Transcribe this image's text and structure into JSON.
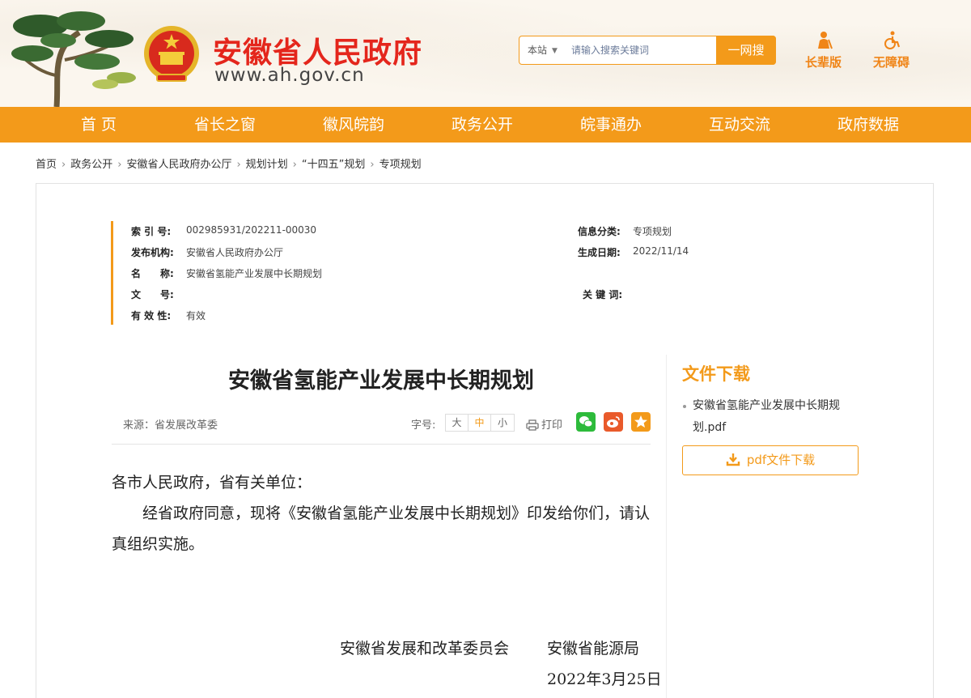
{
  "site": {
    "name": "安徽省人民政府",
    "url": "www.ah.gov.cn"
  },
  "search": {
    "scope": "本站",
    "placeholder": "请输入搜索关键词",
    "button": "一网搜"
  },
  "tools": {
    "elder": "长辈版",
    "accessible": "无障碍"
  },
  "nav": [
    "首 页",
    "省长之窗",
    "徽风皖韵",
    "政务公开",
    "皖事通办",
    "互动交流",
    "政府数据"
  ],
  "breadcrumb": [
    "首页",
    "政务公开",
    "安徽省人民政府办公厅",
    "规划计划",
    "“十四五”规划",
    "专项规划"
  ],
  "info": {
    "index_label": "索 引 号:",
    "index_value": "002985931/202211-00030",
    "category_label": "信息分类:",
    "category_value": "专项规划",
    "publisher_label": "发布机构:",
    "publisher_value": "安徽省人民政府办公厅",
    "date_label": "生成日期:",
    "date_value": "2022/11/14",
    "name_label": "名　　称:",
    "name_value": "安徽省氢能产业发展中长期规划",
    "docno_label": "文　　号:",
    "docno_value": "",
    "keywords_label": "关 键 词:",
    "keywords_value": "",
    "validity_label": "有 效 性:",
    "validity_value": "有效"
  },
  "article": {
    "title": "安徽省氢能产业发展中长期规划",
    "source": "来源：省发展改革委",
    "font_label": "字号:",
    "font_sizes": [
      "大",
      "中",
      "小"
    ],
    "print": "打印",
    "salutation": "各市人民政府，省有关单位：",
    "paragraph": "经省政府同意，现将《安徽省氢能产业发展中长期规划》印发给你们，请认真组织实施。",
    "signer_1": "安徽省发展和改革委员会",
    "signer_2": "安徽省能源局",
    "sign_date": "2022年3月25日"
  },
  "side": {
    "title": "文件下载",
    "file_name": "安徽省氢能产业发展中长期规划.pdf",
    "download_button": "pdf文件下载"
  },
  "colors": {
    "accent": "#f39a1a",
    "brand_red": "#e4261c",
    "wechat": "#2dbb3b",
    "weibo": "#e95a2b",
    "favorite": "#f39a1a"
  }
}
